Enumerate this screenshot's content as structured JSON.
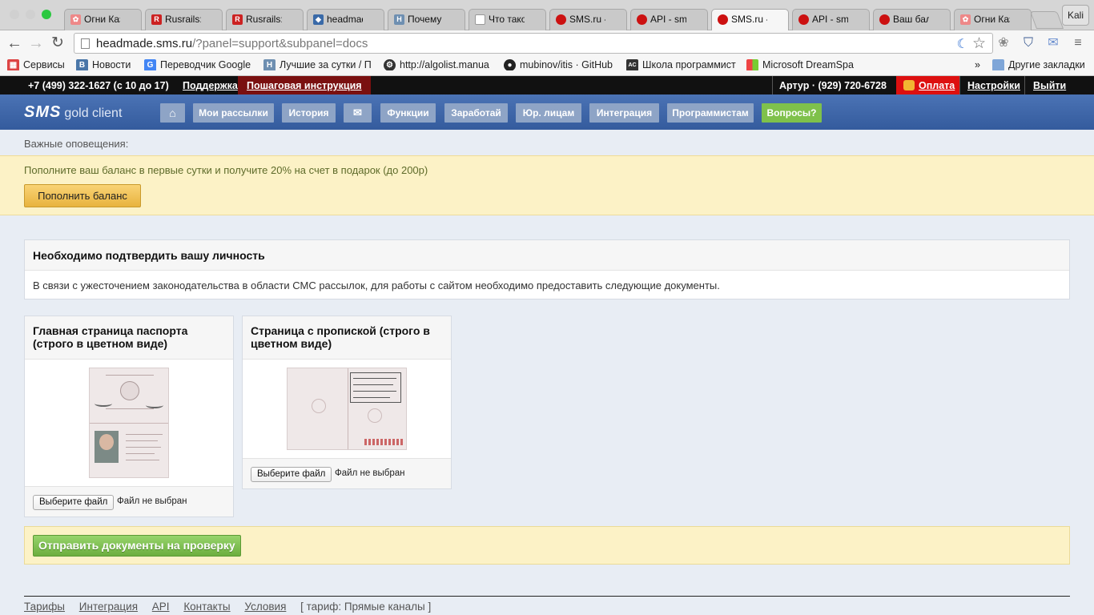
{
  "browser": {
    "tabs": [
      {
        "title": "Огни Каз",
        "icon": "flower-icon",
        "color": "#e88"
      },
      {
        "title": "Rusrails:",
        "icon": "rusrails-icon",
        "color": "#c22"
      },
      {
        "title": "Rusrails:",
        "icon": "rusrails-icon",
        "color": "#c22"
      },
      {
        "title": "headmad",
        "icon": "shield-icon",
        "color": "#3a6aa8"
      },
      {
        "title": "Почему и",
        "icon": "habr-icon",
        "color": "#6e8fb1"
      },
      {
        "title": "Что такое",
        "icon": "page-icon",
        "color": "#fff"
      },
      {
        "title": "SMS.ru -",
        "icon": "cherry-icon",
        "color": "#c11"
      },
      {
        "title": "API - sms",
        "icon": "cherry-icon",
        "color": "#c11"
      },
      {
        "title": "SMS.ru -",
        "icon": "cherry-icon",
        "color": "#c11"
      },
      {
        "title": "API - sms",
        "icon": "cherry-icon",
        "color": "#c11"
      },
      {
        "title": "Ваш бала",
        "icon": "cherry-icon",
        "color": "#c11"
      },
      {
        "title": "Огни Каз",
        "icon": "flower-icon",
        "color": "#e88"
      }
    ],
    "profile": "Kali",
    "url_host": "headmade.sms.ru",
    "url_rest": "/?panel=support&subpanel=docs",
    "bookmarks": [
      {
        "label": "Сервисы",
        "icon": "apps-icon",
        "color": "#d44"
      },
      {
        "label": "Новости",
        "icon": "vk-icon",
        "color": "#4a76a8"
      },
      {
        "label": "Переводчик Google",
        "icon": "translate-icon",
        "color": "#4285f4"
      },
      {
        "label": "Лучшие за сутки / П",
        "icon": "habr-icon",
        "color": "#6e8fb1"
      },
      {
        "label": "http://algolist.manua",
        "icon": "gear-icon",
        "color": "#333"
      },
      {
        "label": "mubinov/itis · GitHub",
        "icon": "github-icon",
        "color": "#222"
      },
      {
        "label": "Школа программист",
        "icon": "school-icon",
        "color": "#333"
      },
      {
        "label": "Microsoft DreamSpa",
        "icon": "microsoft-icon",
        "color": "#e44"
      }
    ],
    "other_bookmarks": "Другие закладки"
  },
  "topbar": {
    "phone": "+7 (499) 322-1627 (с 10 до 17)",
    "support": "Поддержка",
    "instruction": "Пошаговая инструкция",
    "user": "Артур · (929) 720-6728",
    "pay": "Оплата",
    "settings": "Настройки",
    "logout": "Выйти"
  },
  "nav": {
    "logo": "SMS",
    "logo_sub": "gold client",
    "items": [
      "Мои рассылки",
      "История",
      "Функции",
      "Заработай",
      "Юр. лицам",
      "Интеграция",
      "Программистам",
      "Вопросы?"
    ]
  },
  "alerts": {
    "title": "Важные оповещения:",
    "promo": "Пополните ваш баланс в первые сутки и получите 20% на счет в подарок (до 200р)",
    "promo_button": "Пополнить баланс"
  },
  "verify": {
    "title": "Необходимо подтвердить вашу личность",
    "body": "В связи с ужесточением законодательства в области СМС рассылок, для работы с сайтом необходимо предоставить следующие документы."
  },
  "documents": [
    {
      "title": "Главная страница паспорта (строго в цветном виде)",
      "button": "Выберите файл",
      "status": "Файл не выбран"
    },
    {
      "title": "Страница с пропиской (строго в цветном виде)",
      "button": "Выберите файл",
      "status": "Файл не выбран"
    }
  ],
  "submit_button": "Отправить документы на проверку",
  "footer": {
    "links": [
      "Тарифы",
      "Интеграция",
      "API",
      "Контакты",
      "Условия"
    ],
    "tariff": "[ тариф: Прямые каналы ]"
  }
}
